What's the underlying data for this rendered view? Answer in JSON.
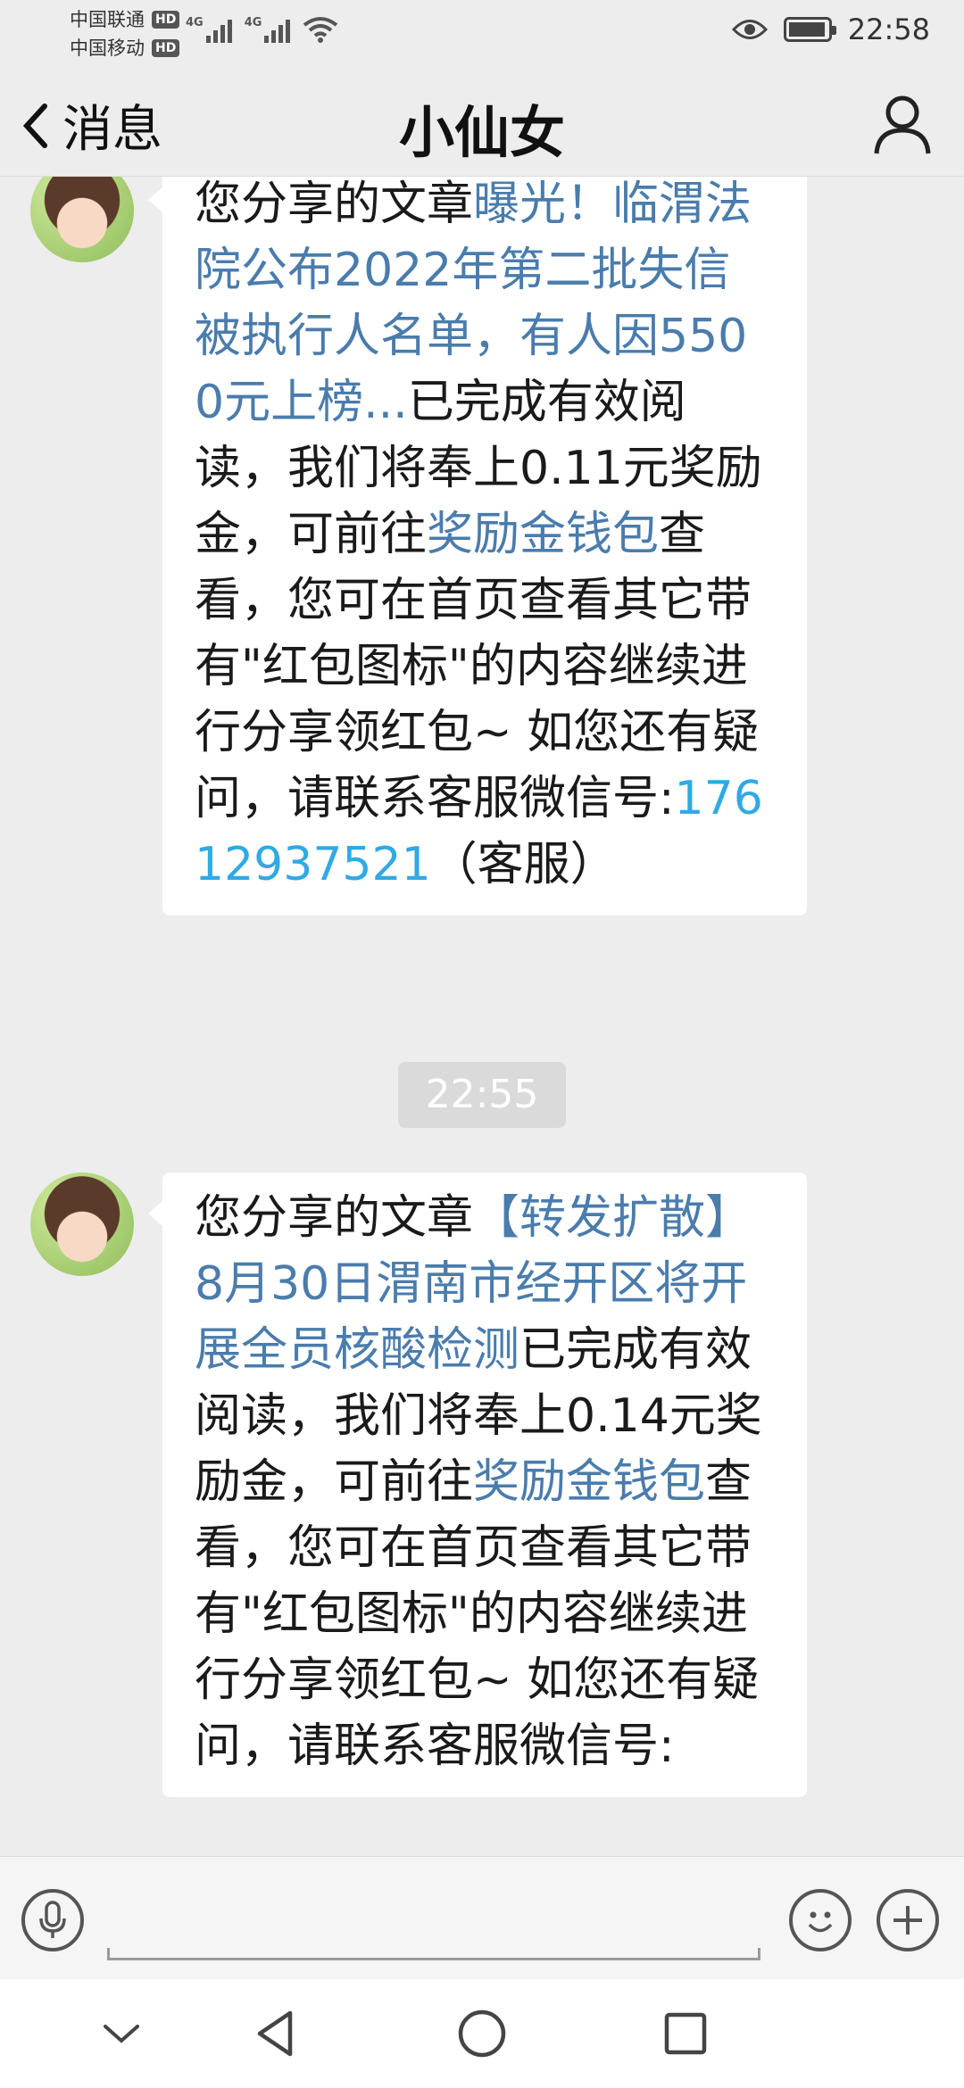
{
  "status_bar": {
    "carrier1": "中国联通",
    "carrier2": "中国移动",
    "hd": "HD",
    "net1": "4G",
    "net2": "4G",
    "time": "22:58"
  },
  "header": {
    "back_label": "消息",
    "title": "小仙女"
  },
  "messages": [
    {
      "prefix": "您分享的文章",
      "article": "曝光！临渭法院公布2022年第二批失信被执行人名单，有人因5500元上榜...",
      "middle": "已完成有效阅读，我们将奉上0.11元奖励金，可前往",
      "wallet": "奖励金钱包",
      "suffix": "查看，您可在首页查看其它带有\"红包图标\"的内容继续进行分享领红包~ 如您还有疑问，请联系客服微信号:",
      "phone": "17612937521",
      "phone_suffix": "（客服）"
    },
    {
      "prefix": "您分享的文章",
      "article": "【转发扩散】8月30日渭南市经开区将开展全员核酸检测",
      "middle": "已完成有效阅读，我们将奉上0.14元奖励金，可前往",
      "wallet": "奖励金钱包",
      "suffix": "查看，您可在首页查看其它带有\"红包图标\"的内容继续进行分享领红包~ 如您还有疑问，请联系客服微信号:"
    }
  ],
  "timestamp": "22:55",
  "colors": {
    "link": "#4a7cac",
    "phone": "#31a9e4",
    "background": "#ededed"
  },
  "icons": [
    "back-chevron-icon",
    "user-profile-icon",
    "eye-icon",
    "battery-icon",
    "wifi-icon",
    "voice-icon",
    "emoji-icon",
    "plus-icon",
    "nav-down-icon",
    "nav-back-icon",
    "nav-home-icon",
    "nav-recents-icon"
  ]
}
